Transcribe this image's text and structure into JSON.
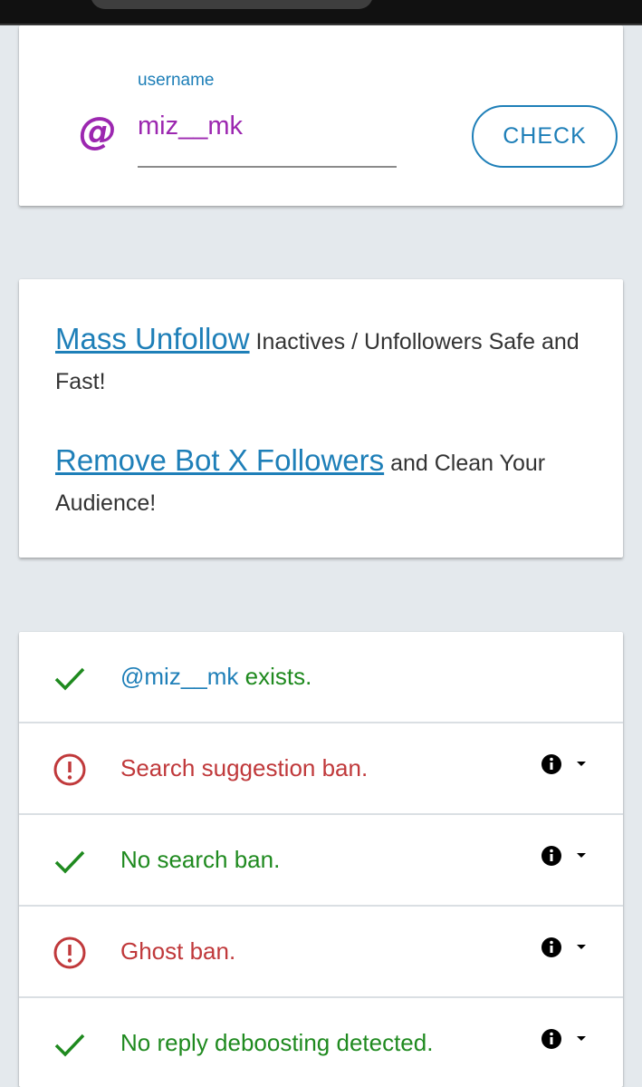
{
  "search": {
    "label": "username",
    "value": "miz__mk",
    "at_symbol": "@",
    "check_label": "CHECK"
  },
  "promo": {
    "mass_unfollow_link": "Mass Unfollow",
    "mass_unfollow_text": " Inactives / Unfollowers Safe and Fast!",
    "remove_bots_link": "Remove Bot X Followers",
    "remove_bots_text": " and Clean Your Audience!"
  },
  "results": [
    {
      "status": "ok",
      "handle": "@miz__mk",
      "text": " exists."
    },
    {
      "status": "bad",
      "text": "Search suggestion ban."
    },
    {
      "status": "ok",
      "text": "No search ban."
    },
    {
      "status": "bad",
      "text": "Ghost ban."
    },
    {
      "status": "ok",
      "text": "No reply deboosting detected."
    }
  ],
  "colors": {
    "accent_blue": "#1e7fb8",
    "purple": "#9c27b0",
    "ok_green": "#1f8a1f",
    "bad_red": "#c0393b"
  },
  "icons": {
    "ok": "checkmark-icon",
    "bad": "alert-circle-icon",
    "info": "info-icon",
    "dropdown": "caret-down-icon"
  }
}
